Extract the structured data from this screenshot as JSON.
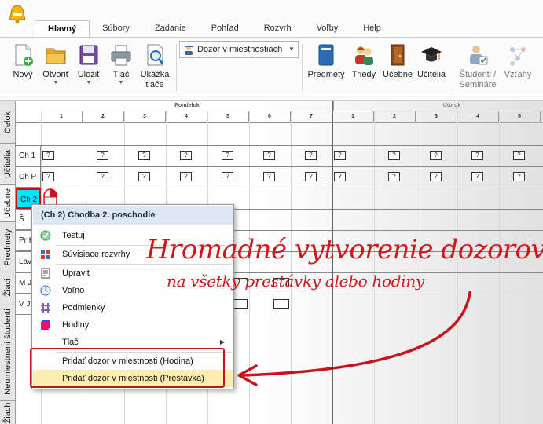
{
  "ribbon": {
    "tabs": [
      "Hlavný",
      "Súbory",
      "Zadanie",
      "Pohľad",
      "Rozvrh",
      "Voľby",
      "Help"
    ],
    "active_tab": "Hlavný",
    "buttons": {
      "new": "Nový",
      "open": "Otvoriť",
      "save": "Uložiť",
      "print": "Tlač",
      "preview_1": "Ukážka",
      "preview_2": "tlače",
      "subjects": "Predmety",
      "classes": "Triedy",
      "classrooms": "Učebne",
      "teachers": "Učitelia",
      "students_1": "Študenti /",
      "students_2": "Semináre",
      "relations": "Vzťahy"
    },
    "view_select": "Dozor v miestnostiach"
  },
  "side_tabs": [
    "Celok",
    "Učitelia",
    "Učebne",
    "Predmety",
    "Žiaci",
    "Neumiestnení študenti",
    "Žiach"
  ],
  "grid": {
    "days": [
      "Pondelok",
      "Utorok"
    ],
    "periods": [
      "1",
      "2",
      "3",
      "4",
      "5",
      "6",
      "7",
      "1",
      "2",
      "3",
      "4",
      "5"
    ],
    "rows": [
      "Ch 1",
      "Ch P",
      "Ch 2",
      "Š",
      "Pr K",
      "Lav",
      "M J",
      "V J"
    ],
    "slot_mark": "?"
  },
  "context_menu": {
    "title": "(Ch 2) Chodba 2. poschodie",
    "items": {
      "test": "Testuj",
      "related": "Súvisiace rozvrhy",
      "edit": "Upraviť",
      "free": "Voľno",
      "conditions": "Podmienky",
      "hours": "Hodiny",
      "print": "Tlač",
      "add_hour": "Pridať dozor v miestnosti (Hodina)",
      "add_break": "Pridať dozor v miestnosti (Prestávka)"
    }
  },
  "promo": {
    "line1": "Hromadné vytvorenie dozorov",
    "line2": "na všetky prestávky alebo hodiny"
  },
  "colors": {
    "accent_red": "#d01818",
    "selected_cyan": "#00e5ff",
    "highlight": "#fdeeb0"
  }
}
